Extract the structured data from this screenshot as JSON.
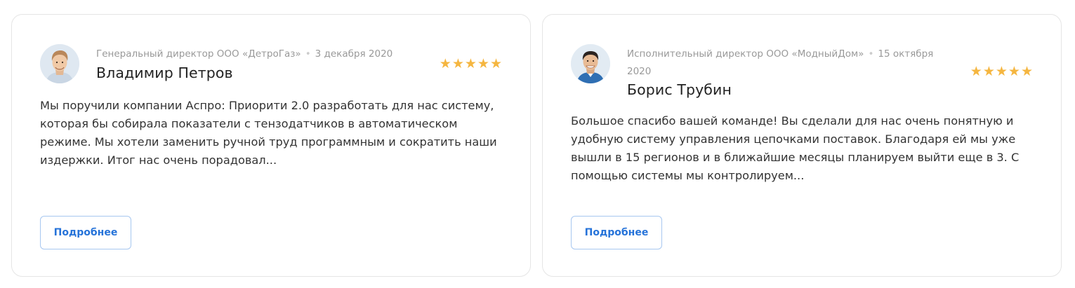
{
  "reviews": [
    {
      "position": "Генеральный директор ООО «ДетроГаз»",
      "separator": "•",
      "date": "3 декабря 2020",
      "name": "Владимир Петров",
      "rating": 5,
      "stars": [
        "★",
        "★",
        "★",
        "★",
        "★"
      ],
      "text": "Мы поручили компании Аспро: Приорити 2.0 разработать для нас систему, которая бы собирала показатели с тензодатчиков в автоматическом режиме. Мы хотели заменить ручной труд программным и сократить наши издержки. Итог нас очень порадовал...",
      "button_label": "Подробнее"
    },
    {
      "position": "Исполнительный директор ООО «МодныйДом»",
      "separator": "•",
      "date": "15 октября 2020",
      "name": "Борис Трубин",
      "rating": 5,
      "stars": [
        "★",
        "★",
        "★",
        "★",
        "★"
      ],
      "text": "Большое спасибо вашей команде! Вы сделали для нас очень понятную и удобную систему управления цепочками поставок. Благодаря ей мы уже вышли в 15 регионов и в ближайшие месяцы планируем выйти еще в 3. С помощью системы мы контролируем...",
      "button_label": "Подробнее"
    }
  ],
  "colors": {
    "star": "#f5b640",
    "button_text": "#2673d9",
    "button_border": "#a7c7f0",
    "card_border": "#e5e5e5",
    "meta_text": "#999999"
  }
}
